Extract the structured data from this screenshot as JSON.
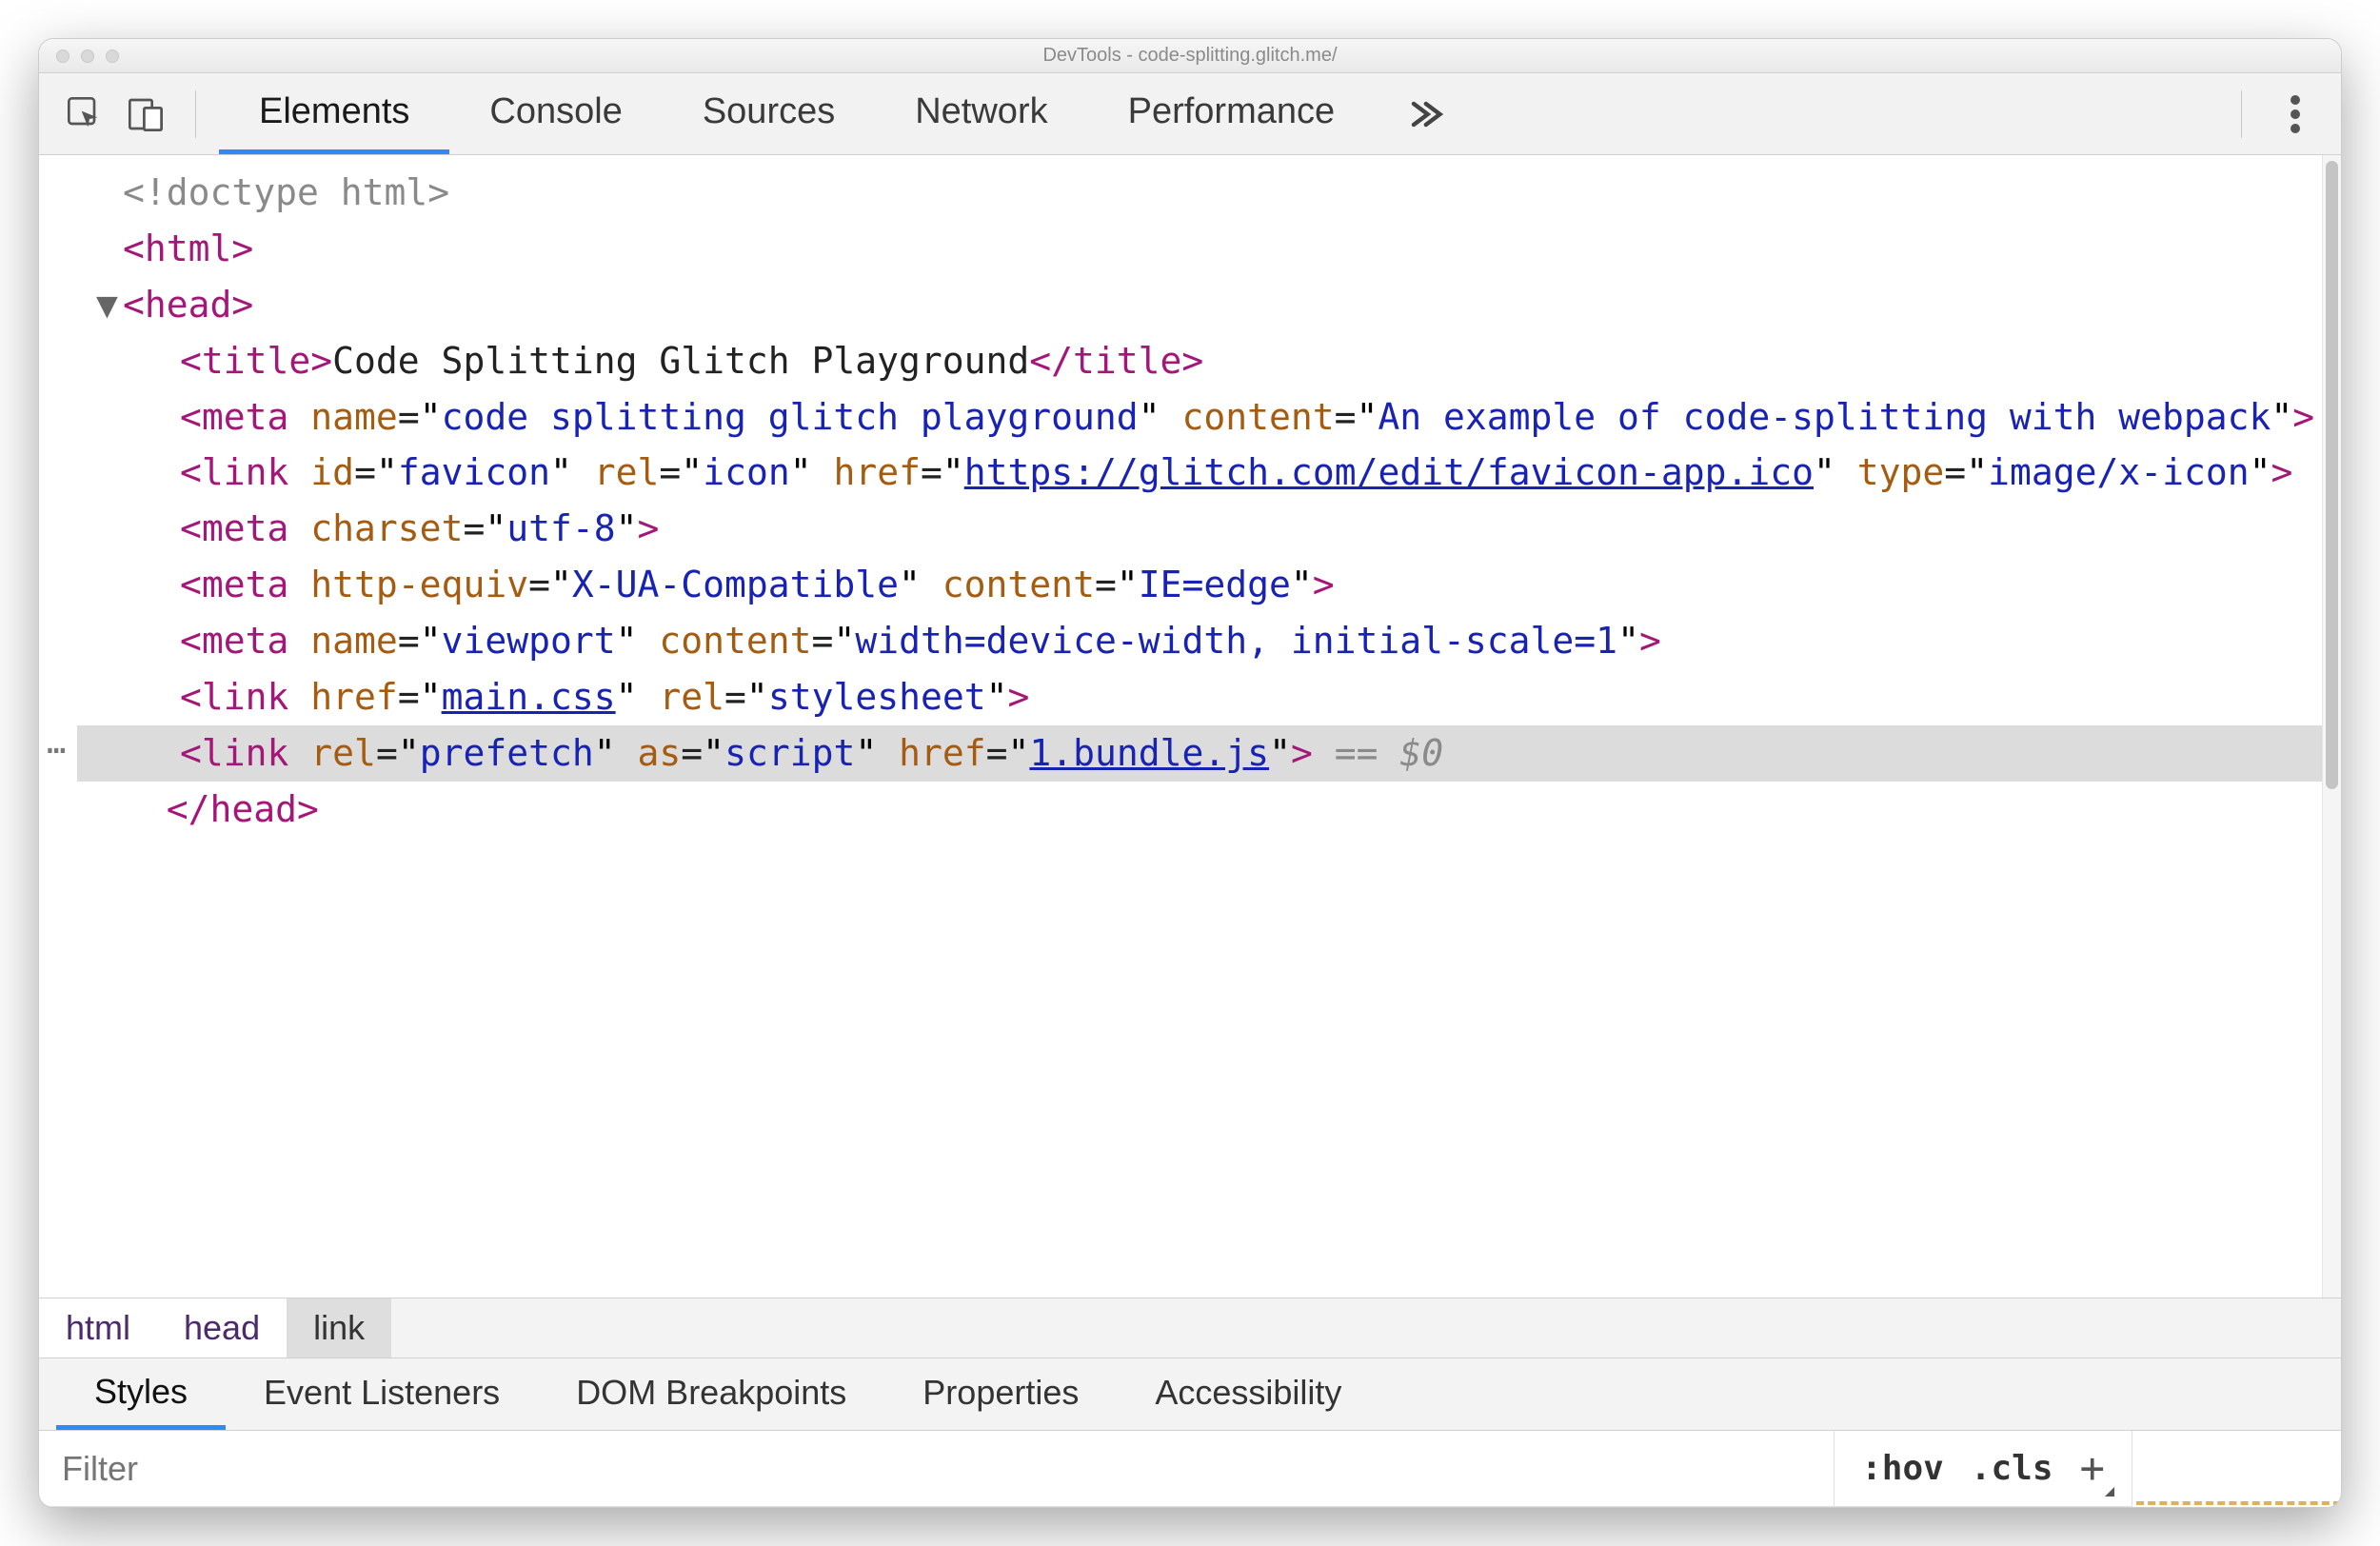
{
  "window": {
    "title": "DevTools - code-splitting.glitch.me/"
  },
  "toolbar": {
    "tabs": [
      "Elements",
      "Console",
      "Sources",
      "Network",
      "Performance"
    ],
    "active_tab": 0
  },
  "dom": {
    "doctype": "<!doctype html>",
    "html_open": "html",
    "head_open": "head",
    "title_tag": "title",
    "title_text": "Code Splitting Glitch Playground",
    "meta1": {
      "tag": "meta",
      "name_attr": "name",
      "name_val": "code splitting glitch playground",
      "content_attr": "content",
      "content_val": "An example of code-splitting with webpack"
    },
    "link1": {
      "tag": "link",
      "id_attr": "id",
      "id_val": "favicon",
      "rel_attr": "rel",
      "rel_val": "icon",
      "href_attr": "href",
      "href_val": "https://glitch.com/edit/favicon-app.ico",
      "type_attr": "type",
      "type_val": "image/x-icon"
    },
    "meta2": {
      "tag": "meta",
      "charset_attr": "charset",
      "charset_val": "utf-8"
    },
    "meta3": {
      "tag": "meta",
      "he_attr": "http-equiv",
      "he_val": "X-UA-Compatible",
      "content_attr": "content",
      "content_val": "IE=edge"
    },
    "meta4": {
      "tag": "meta",
      "name_attr": "name",
      "name_val": "viewport",
      "content_attr": "content",
      "content_val": "width=device-width, initial-scale=1"
    },
    "link2": {
      "tag": "link",
      "href_attr": "href",
      "href_val": "main.css",
      "rel_attr": "rel",
      "rel_val": "stylesheet"
    },
    "link3": {
      "tag": "link",
      "rel_attr": "rel",
      "rel_val": "prefetch",
      "as_attr": "as",
      "as_val": "script",
      "href_attr": "href",
      "href_val": "1.bundle.js"
    },
    "selected_suffix": " == $0",
    "head_close": "head"
  },
  "breadcrumb": [
    "html",
    "head",
    "link"
  ],
  "styles_tabs": [
    "Styles",
    "Event Listeners",
    "DOM Breakpoints",
    "Properties",
    "Accessibility"
  ],
  "styles": {
    "filter_placeholder": "Filter",
    "hov_label": ":hov",
    "cls_label": ".cls"
  }
}
